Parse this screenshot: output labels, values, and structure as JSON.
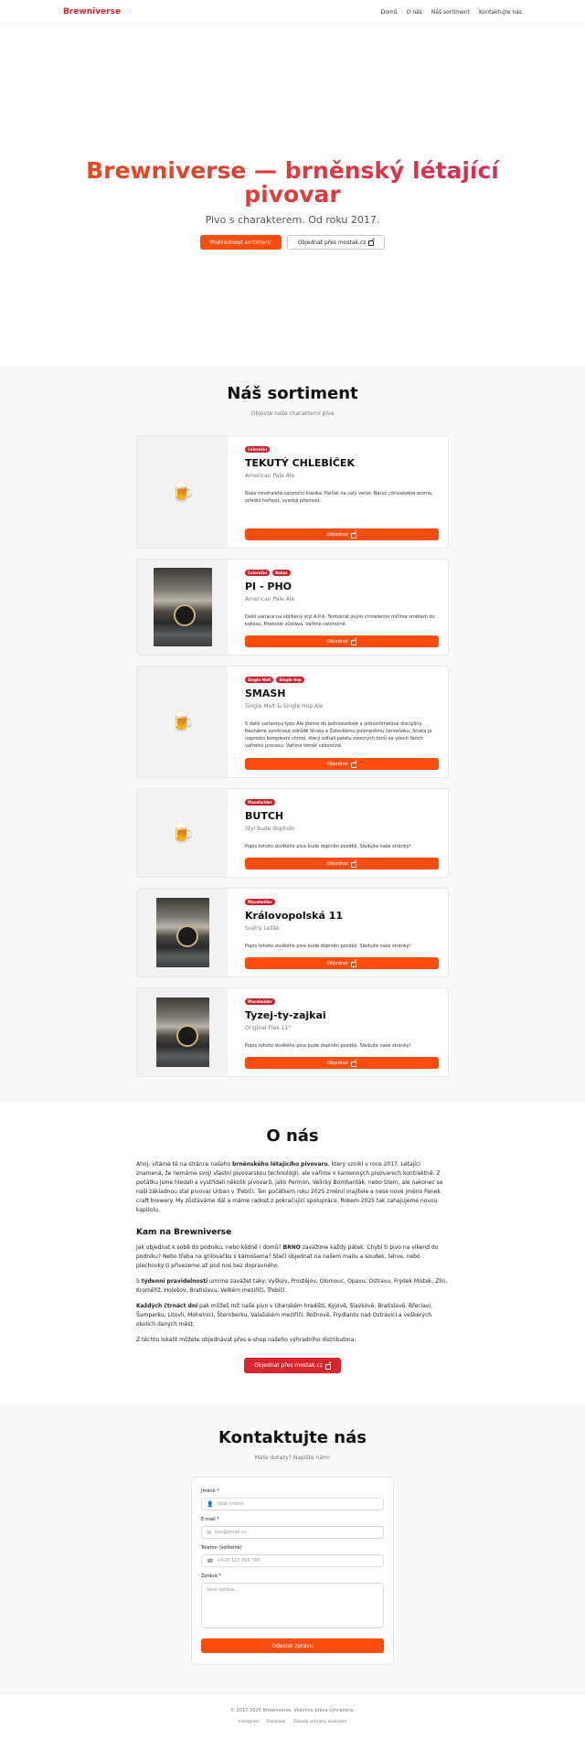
{
  "header": {
    "brand": "Brewniverse",
    "nav": [
      "Domů",
      "O nás",
      "Náš sortiment",
      "Kontaktujte nás"
    ]
  },
  "hero": {
    "title": "Brewniverse — brněnský létající pivovar",
    "subtitle": "Pivo s charakterem. Od roku 2017.",
    "primary_button": "Prohlédnout sortiment",
    "secondary_button": "Objednat přes mostak.cz"
  },
  "sortiment": {
    "title": "Náš sortiment",
    "subtitle": "Objevte naše charakterní piva",
    "order_label": "Objednat",
    "products": [
      {
        "name": "TEKUTÝ CHLEBÍČEK",
        "type": "American Pale Ale",
        "badges": [
          "Celoroční"
        ],
        "image": "beer-mug-icon",
        "desc": "Naše mnohaletá celoroční klasika. Parťák na celý večer. Náruč citrusového aroma, střední hořkost, vysoká pitelnost."
      },
      {
        "name": "PI - PHO",
        "type": "American Pale Ale",
        "badges": [
          "Celoroční",
          "Bokos"
        ],
        "image": "brewery-photo",
        "desc": "Další variace na oblíbený styl A.P.A. Tentokrát jiným chmelením míříme směrem do kokosu. Pitelnost zůstává. Vaříme celoročně."
      },
      {
        "name": "SMASH",
        "type": "Single Malt & Single Hop Ale",
        "badges": [
          "Single Malt",
          "Single Hop"
        ],
        "image": "beer-mug-icon",
        "desc": "S další variantou typu Ale jdeme do jednosladové a jednochmelové disciplíny. Necháme vyniknout odrůdě Strata a Žateckému poloraněmu červeňáku. Strata je naprosto komplexní chmel, který odhalí paletu ovocných tónů ve všech fázích vařného procesu. Vaříme téměř celoročně."
      },
      {
        "name": "BUTCH",
        "type": "Styl bude doplněn",
        "badges": [
          "Placeholder"
        ],
        "image": "beer-mug-icon",
        "desc": "Popis tohoto skvělého piva bude doplněn později. Sledujte naše stránky!"
      },
      {
        "name": "Královopolská 11",
        "type": "Světlý Ležák",
        "badges": [
          "Placeholder"
        ],
        "image": "brewery-photo",
        "desc": "Popis tohoto skvělého piva bude doplněn později. Sledujte naše stránky!"
      },
      {
        "name": "Tyzej-ty-zajkai",
        "type": "Original Flek 11°",
        "badges": [
          "Placeholder"
        ],
        "image": "brewery-photo",
        "desc": "Popis tohoto skvělého piva bude doplněn později. Sledujte naše stránky!"
      }
    ]
  },
  "about": {
    "title": "O nás",
    "p1_pre": "Ahoj, vítáme tě na stránce našeho ",
    "p1_bold": "brněnského létajícího pivovaru",
    "p1_post": ", který vznikl v roce 2017. Létající znamená, že nemáme svoji vlastní pivovarskou technologii, ale vaříme v kamenných pivovarech kontraktně. Z počátku jsme hledali a vystřídali několik pivovarů, jako Permon, Velický Bombardák, nebo Stern, ale nakonec se naší základnou stal pivovar Urban v Třebíči. Ten počátkem roku 2025 změnil majitele a nese nové jméno Fenek craft brewery. My zůstáváme dál a máme radost z pokračující spolupráce. Rokem 2025 tak zahajujeme novou kapitolu.",
    "subtitle": "Kam na Brewniverse",
    "p2_pre": "Jak objednat k sobě do podniku, nebo klidně i domů? ",
    "p2_bold": "BRNO",
    "p2_post": " zavážíme každý pátek. Chybí ti pivo na víkend do podniku? Nebo třeba na grilovačku s kámošema? Stačí objednat na našem mailu a soudek, lahve, nebo plechovky ti přivezeme až pod nos bez dopravného.",
    "p3_pre": "S ",
    "p3_bold": "týdenní pravidelností",
    "p3_post": " umíme zavážet taky: Vyškov, Prostějov, Olomouc, Opavu, Ostravu, Frýdek Místek, Zlín, Kroměříž, Holešov, Bratislavu, Velkém meziříčí, Třebíčí.",
    "p4_bold": "Každých čtrnáct dní",
    "p4_post": " pak můžeš mít naše pivo v Uherském hradišti, Kyjově, Slavkově, Bratislavě, Břeclavi, Šumperku, Litovli, Mohelnici, Šternberku, Valašském meziříčí, Rožnově, Frýdlantu nad Ostravicí a veškerých okolích daných měst.",
    "p5": "Z těchto lokalit můžete objednávat přes e-shop našeho výhradního distributora:",
    "cta": "Objednat přes mostak.cz"
  },
  "contact": {
    "title": "Kontaktujte nás",
    "subtitle": "Máte dotazy? Napište nám!",
    "name_label": "Jméno *",
    "name_placeholder": "Vaše jméno",
    "email_label": "E-mail *",
    "email_placeholder": "vas@email.cz",
    "phone_label": "Telefon (volitelné)",
    "phone_placeholder": "+420 123 456 789",
    "message_label": "Zpráva *",
    "message_placeholder": "Vaše zpráva...",
    "submit": "Odeslat zprávu"
  },
  "footer": {
    "copyright": "© 2017-2025 Brewniverse. Všechna práva vyhrazena.",
    "links": [
      "Instagram",
      "Facebook",
      "Zásady ochrany soukromí"
    ]
  }
}
